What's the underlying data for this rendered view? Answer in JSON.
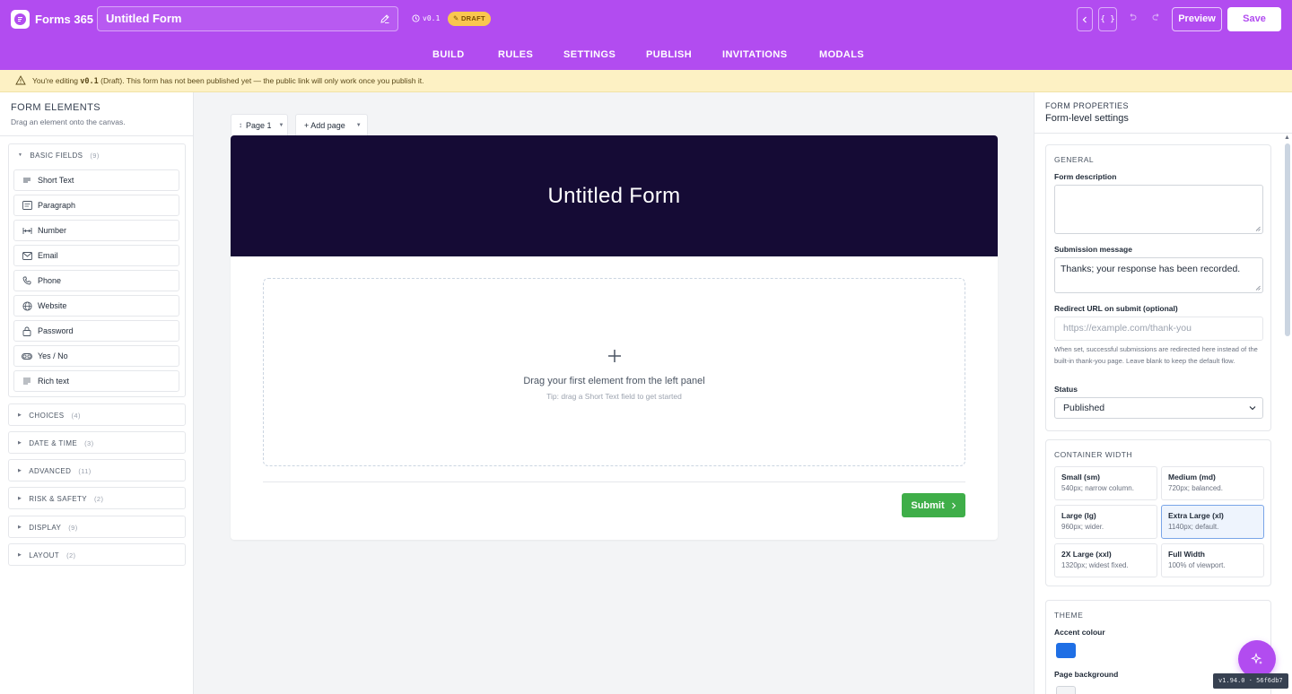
{
  "app": {
    "brand": "Forms 365",
    "form_title": "Untitled Form",
    "version": "v0.1",
    "draft_label": "DRAFT",
    "preview_label": "Preview",
    "save_label": "Save",
    "code_label": "{ }"
  },
  "tabs": [
    "BUILD",
    "RULES",
    "SETTINGS",
    "PUBLISH",
    "INVITATIONS",
    "MODALS"
  ],
  "banner": {
    "prefix": "You're editing ",
    "version": "v0.1",
    "suffix": " (Draft). This form has not been published yet — the public link will only work once you publish it."
  },
  "left_panel": {
    "title": "FORM ELEMENTS",
    "subtitle": "Drag an element onto the canvas.",
    "basic": {
      "label": "BASIC FIELDS",
      "count": "(9)"
    },
    "fields": [
      "Short Text",
      "Paragraph",
      "Number",
      "Email",
      "Phone",
      "Website",
      "Password",
      "Yes / No",
      "Rich text"
    ],
    "categories": [
      {
        "label": "CHOICES",
        "count": "(4)"
      },
      {
        "label": "DATE & TIME",
        "count": "(3)"
      },
      {
        "label": "ADVANCED",
        "count": "(11)"
      },
      {
        "label": "RISK & SAFETY",
        "count": "(2)"
      },
      {
        "label": "DISPLAY",
        "count": "(9)"
      },
      {
        "label": "LAYOUT",
        "count": "(2)"
      }
    ]
  },
  "canvas": {
    "page_tab": "Page 1",
    "add_page": "+ Add page",
    "form_heading": "Untitled Form",
    "drop_text": "Drag your first element from the left panel",
    "drop_tip": "Tip: drag a Short Text field to get started",
    "submit_label": "Submit"
  },
  "right_panel": {
    "title": "FORM PROPERTIES",
    "subtitle": "Form-level settings",
    "general": {
      "title": "GENERAL",
      "description_label": "Form description",
      "description_value": "",
      "submission_label": "Submission message",
      "submission_value": "Thanks; your response has been recorded.",
      "redirect_label": "Redirect URL on submit (optional)",
      "redirect_placeholder": "https://example.com/thank-you",
      "redirect_help": "When set, successful submissions are redirected here instead of the built-in thank-you page. Leave blank to keep the default flow.",
      "status_label": "Status",
      "status_value": "Published"
    },
    "container": {
      "title": "CONTAINER WIDTH",
      "options": [
        {
          "name": "Small (sm)",
          "desc": "540px; narrow column."
        },
        {
          "name": "Medium (md)",
          "desc": "720px; balanced."
        },
        {
          "name": "Large (lg)",
          "desc": "960px; wider."
        },
        {
          "name": "Extra Large (xl)",
          "desc": "1140px; default."
        },
        {
          "name": "2X Large (xxl)",
          "desc": "1320px; widest fixed."
        },
        {
          "name": "Full Width",
          "desc": "100% of viewport."
        }
      ],
      "selected": "Extra Large (xl)"
    },
    "theme": {
      "title": "THEME",
      "accent_label": "Accent colour",
      "accent_color": "#1f6fe5",
      "page_bg_label": "Page background",
      "page_bg_color": "#f3f4f6"
    }
  },
  "build_badge": "v1.94.0 · 56f6db7",
  "colors": {
    "brand": "#b24cf0",
    "hero": "#150b35",
    "submit": "#3fae49",
    "banner": "#fdf1c4"
  },
  "icons": [
    "pencil-icon",
    "clock-icon",
    "undo-icon",
    "redo-icon",
    "chevron-left-icon",
    "warning-icon",
    "sparkle-icon",
    "plus-icon",
    "chevron-right-icon",
    "chevron-down-icon"
  ]
}
